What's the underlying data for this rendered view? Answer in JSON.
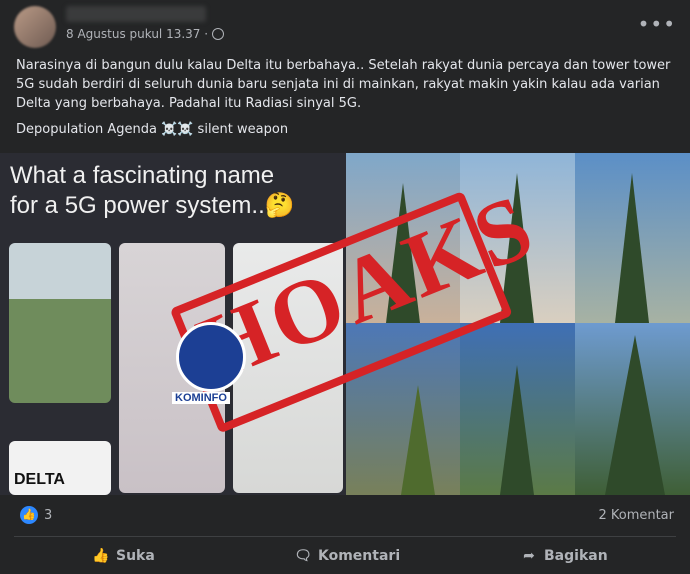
{
  "post": {
    "timestamp": "8 Agustus pukul 13.37 ·",
    "paragraph1": "Narasinya di bangun dulu kalau Delta itu berbahaya.. Setelah rakyat dunia percaya dan tower tower 5G sudah berdiri di seluruh dunia baru senjata ini di mainkan, rakyat makin yakin kalau ada varian Delta yang berbahaya. Padahal itu Radiasi sinyal 5G.",
    "paragraph2": "Depopulation Agenda ☠️☠️ silent weapon"
  },
  "image": {
    "meme_line1": "What a fascinating name",
    "meme_line2": "for a 5G power system..🤔",
    "delta_logo": "DELTA",
    "stamp_text": "HOAKS",
    "kominfo_label": "KOMINFO"
  },
  "reactions": {
    "like_count": "3",
    "comment_count": "2 Komentar"
  },
  "actions": {
    "like": "Suka",
    "comment": "Komentari",
    "share": "Bagikan"
  },
  "colors": {
    "background": "#242526",
    "stamp_red": "#d62326",
    "like_blue": "#2d88ff"
  }
}
